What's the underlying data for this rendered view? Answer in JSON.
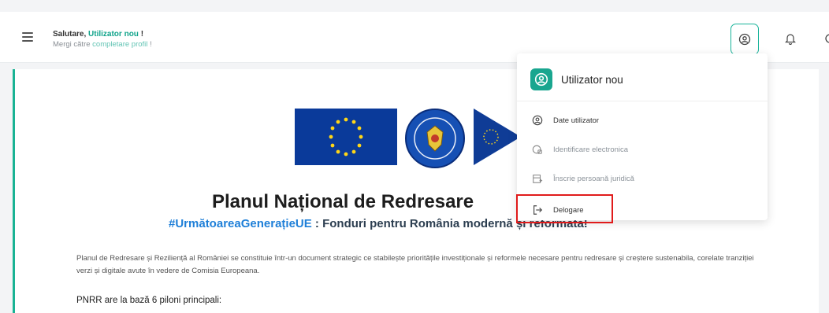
{
  "header": {
    "greeting_prefix": "Salutare, ",
    "user_name": "Utilizator nou",
    "greeting_suffix": " !",
    "goto_prefix": "Mergi către ",
    "goto_link": "completare profil",
    "goto_suffix": " !"
  },
  "menu": {
    "title": "Utilizator nou",
    "items": [
      {
        "label": "Date utilizator",
        "icon": "user-circle-icon"
      },
      {
        "label": "Identificare electronica",
        "icon": "shield-check-icon"
      },
      {
        "label": "Înscrie persoană juridică",
        "icon": "building-icon"
      },
      {
        "label": "Delogare",
        "icon": "logout-icon"
      }
    ]
  },
  "content": {
    "title": "Planul Național de Redresare",
    "subtitle_tag": "#UrmătoareaGenerațieUE",
    "subtitle_rest": " : Fonduri pentru România modernă și reformată!",
    "paragraph": "Planul de Redresare și Reziliență al României se constituie într-un document strategic ce stabilește prioritățile investiționale și reformele necesare pentru redresare și creștere sustenabila, corelate tranziției verzi și digitale avute în vedere de Comisia Europeana.",
    "pillars_intro": "PNRR are la bază 6 piloni principali:"
  },
  "colors": {
    "accent": "#19b394",
    "link": "#1e7fd8",
    "highlight": "#e01b1b"
  }
}
